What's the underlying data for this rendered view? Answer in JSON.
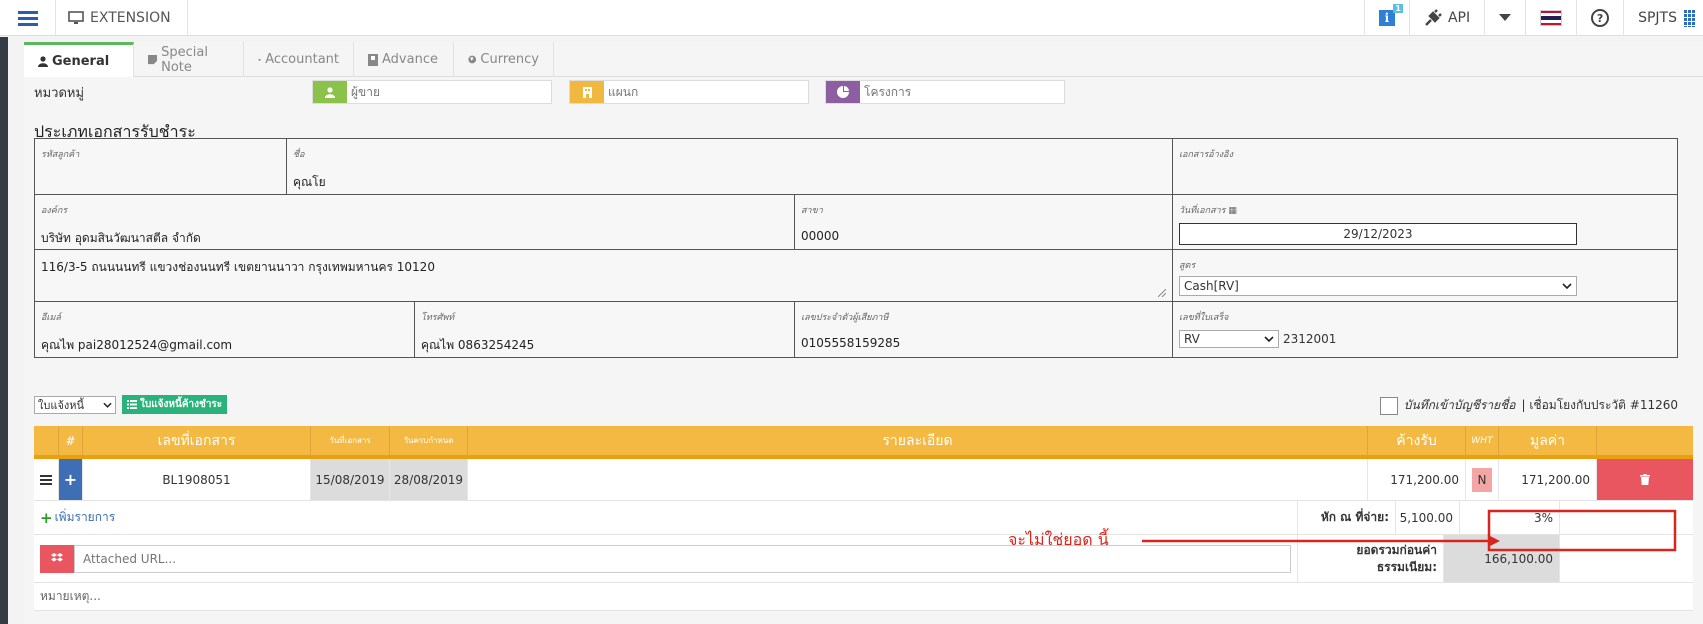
{
  "topbar": {
    "section": "EXTENSION",
    "info_badge": "1",
    "api_label": "API",
    "user_label": "SPJTS"
  },
  "tabs": [
    {
      "label": "General",
      "icon": "user-icon"
    },
    {
      "label": "Special Note",
      "icon": "note-icon"
    },
    {
      "label": "Accountant",
      "icon": "graduation-cap-icon"
    },
    {
      "label": "Advance",
      "icon": "book-icon"
    },
    {
      "label": "Currency",
      "icon": "globe-icon"
    }
  ],
  "category": {
    "label": "หมวดหมู่",
    "seller_placeholder": "ผู้ขาย",
    "department_placeholder": "แผนก",
    "project_placeholder": "โครงการ",
    "colors": {
      "seller": "#8bc34a",
      "department": "#f0b840",
      "project": "#8e5ea2"
    }
  },
  "doc_type_title": "ประเภทเอกสารรับชำระ",
  "form": {
    "customer_code_label": "รหัสลูกค้า",
    "customer_code": "",
    "name_label": "ชื่อ",
    "name": "คุณโย",
    "ref_doc_label": "เอกสารอ้างอิง",
    "ref_doc": "",
    "org_label": "องค์กร",
    "org": "บริษัท อุดมสินวัฒนาสตีล จำกัด",
    "branch_label": "สาขา",
    "branch": "00000",
    "doc_date_label": "วันที่เอกสาร",
    "doc_date": "29/12/2023",
    "address": "116/3-5  ถนนนนทรี แขวงช่องนนทรี  เขตยานนาวา  กรุงเทพมหานคร 10120",
    "formula_label": "สูตร",
    "formula": "Cash[RV]",
    "email_label": "อีเมล์",
    "email": "คุณไพ pai28012524@gmail.com",
    "phone_label": "โทรศัพท์",
    "phone": "คุณไพ 0863254245",
    "tax_id_label": "เลขประจำตัวผู้เสียภาษี",
    "tax_id": "0105558159285",
    "receipt_no_label": "เลขที่ใบเสร็จ",
    "receipt_prefix": "RV",
    "receipt_no": "2312001"
  },
  "invoice_select": "ใบแจ้งหนี้",
  "unpaid_button": "ใบแจ้งหนี้ค้างชำระ",
  "post_checkbox_label": "บันทึกเข้าบัญชีรายชื่อ",
  "link_history": "| เชื่อมโยงกับประวัติ #11260",
  "lines": {
    "headers": {
      "num": "#",
      "doc_no": "เลขที่เอกสาร",
      "doc_date": "วันที่เอกสาร",
      "due_date": "วันครบกำหนด",
      "detail": "รายละเอียด",
      "receivable": "ค้างรับ",
      "wht": "WHT",
      "amount": "มูลค่า"
    },
    "rows": [
      {
        "doc_no": "BL1908051",
        "doc_date": "15/08/2019",
        "due_date": "28/08/2019",
        "detail": "",
        "receivable": "171,200.00",
        "wht": "N",
        "amount": "171,200.00"
      }
    ],
    "add_item": "เพิ่มรายการ",
    "wht_label": "หัก ณ ที่จ่าย:",
    "wht_amount": "5,100.00",
    "wht_percent": "3%",
    "attached_placeholder": "Attached URL...",
    "total_label_1": "ยอดรวมก่อนค่า",
    "total_label_2": "ธรรมเนียม:",
    "total_value": "166,100.00",
    "remark_placeholder": "หมายเหตุ..."
  },
  "annotation": "จะไม่ใช่ยอด นี้"
}
